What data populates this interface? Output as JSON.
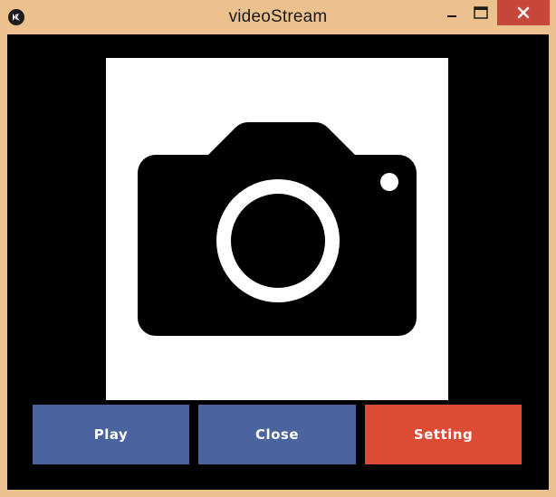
{
  "window": {
    "title": "videoStream"
  },
  "titlebar": {
    "app_icon": "kivy-logo-icon",
    "minimize_icon": "minimize-icon",
    "maximize_icon": "maximize-icon",
    "close_icon": "close-icon"
  },
  "preview": {
    "icon": "camera-icon"
  },
  "buttons": {
    "play_label": "Play",
    "close_label": "Close",
    "setting_label": "Setting"
  },
  "colors": {
    "frame": "#ecc18e",
    "background": "#000000",
    "play_button": "#4b64a0",
    "close_button": "#4b64a0",
    "setting_button": "#dc4b33",
    "window_close_button": "#c6463a"
  }
}
